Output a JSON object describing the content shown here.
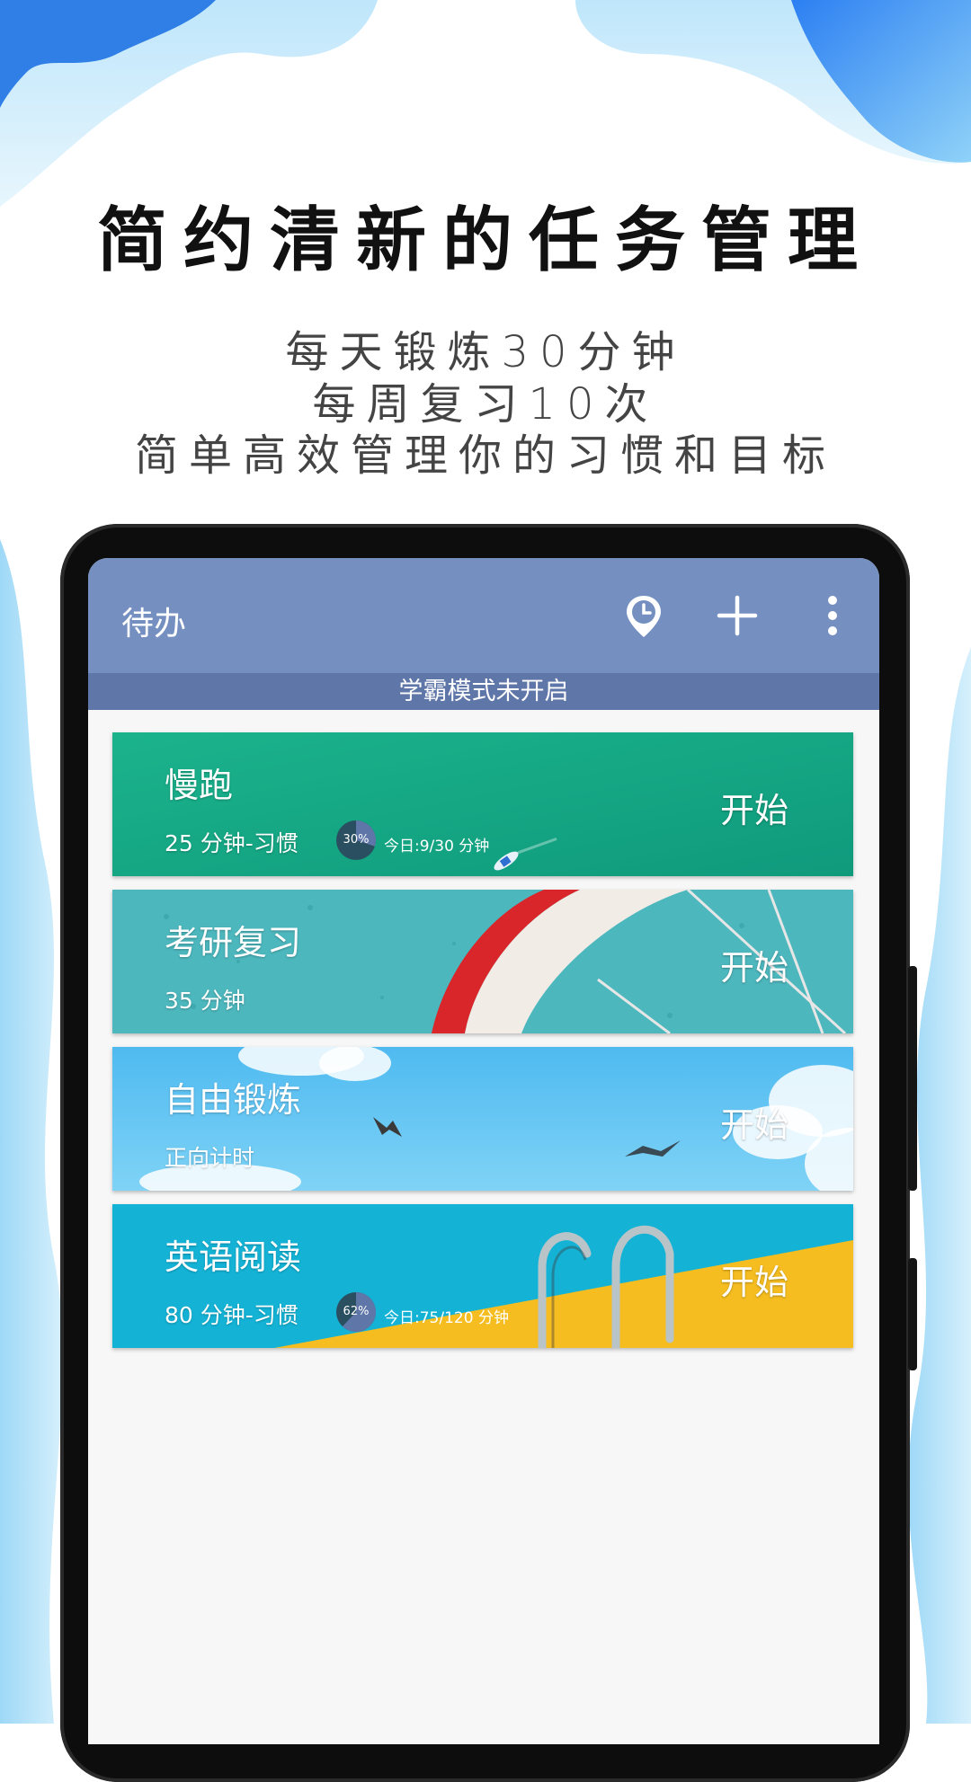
{
  "promo": {
    "headline": "简约清新的任务管理",
    "lines": [
      "每天锻炼30分钟",
      "每周复习10次",
      "简单高效管理你的习惯和目标"
    ]
  },
  "app": {
    "title": "待办",
    "toolbar_icons": [
      "clock-pin-icon",
      "add-icon",
      "more-vert-icon"
    ],
    "status": "学霸模式未开启"
  },
  "tasks": [
    {
      "title": "慢跑",
      "subtitle": "25 分钟-习惯",
      "progress_label": "30%",
      "progress": 0.3,
      "today": "今日:9/30 分钟",
      "start": "开始",
      "bg": "teal-sea-with-boat"
    },
    {
      "title": "考研复习",
      "subtitle": "35 分钟",
      "start": "开始",
      "bg": "teal-wall-with-bicycle-wheel"
    },
    {
      "title": "自由锻炼",
      "subtitle": "正向计时",
      "start": "开始",
      "bg": "blue-sky-with-birds"
    },
    {
      "title": "英语阅读",
      "subtitle": "80 分钟-习惯",
      "progress_label": "62%",
      "progress": 0.62,
      "today": "今日:75/120 分钟",
      "start": "开始",
      "bg": "pool-ladder-with-yellow-edge"
    }
  ],
  "colors": {
    "appbar": "#7590c0",
    "status_strip": "#5f76a8",
    "card1": "#16a583",
    "card2": "#4cb7bd",
    "card3": "#5cc4ee",
    "card4": "#14b3d6",
    "pool_yellow": "#f5bd20"
  }
}
